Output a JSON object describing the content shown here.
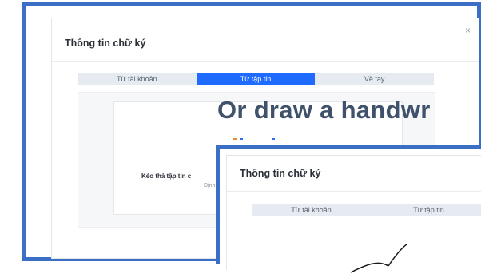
{
  "overlay": {
    "text": "Or draw a handwr"
  },
  "back_dialog": {
    "title": "Thông tin chữ ký",
    "close_glyph": "×",
    "tabs": [
      {
        "label": "Từ tài khoản",
        "active": false
      },
      {
        "label": "Từ tập tin",
        "active": true
      },
      {
        "label": "Vẽ tay",
        "active": false
      }
    ],
    "dropzone": {
      "title": "Kéo thả tập tin c",
      "subtitle": "Định"
    }
  },
  "front_dialog": {
    "title": "Thông tin chữ ký",
    "tabs": [
      {
        "label": "Từ tài khoản",
        "active": false
      },
      {
        "label": "Từ tập tin",
        "active": false
      }
    ]
  },
  "colors": {
    "frame": "#3b6fc6",
    "active_tab": "#1f6bff",
    "tab": "#e6ebf1"
  }
}
